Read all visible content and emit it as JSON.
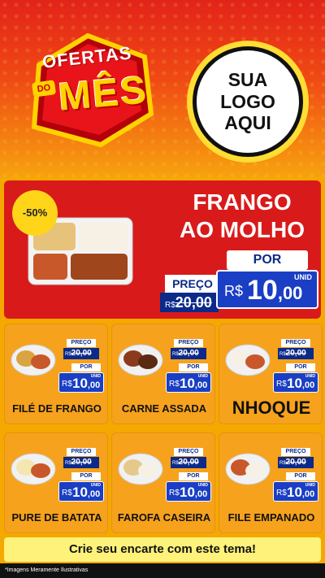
{
  "header": {
    "badge_top": "OFERTAS",
    "badge_do": "DO",
    "badge_main": "MÊS",
    "logo_lines": [
      "SUA",
      "LOGO",
      "AQUI"
    ]
  },
  "featured": {
    "discount": "-50%",
    "name_line1": "FRANGO",
    "name_line2": "AO MOLHO",
    "preco_label": "PREÇO",
    "old_currency": "R$",
    "old_price_int": "20",
    "old_price_dec": ",00",
    "por_label": "POR",
    "unid_label": "UNID",
    "new_currency": "R$",
    "new_price_int": "10",
    "new_price_dec": ",00"
  },
  "products": [
    {
      "name": "FILÉ DE FRANGO",
      "preco_label": "PREÇO",
      "old_currency": "R$",
      "old_price_int": "20",
      "old_price_dec": ",00",
      "por_label": "POR",
      "unid_label": "UNID",
      "new_currency": "R$",
      "new_price_int": "10",
      "new_price_dec": ",00"
    },
    {
      "name": "CARNE ASSADA",
      "preco_label": "PREÇO",
      "old_currency": "R$",
      "old_price_int": "20",
      "old_price_dec": ",00",
      "por_label": "POR",
      "unid_label": "UNID",
      "new_currency": "R$",
      "new_price_int": "10",
      "new_price_dec": ",00"
    },
    {
      "name": "NHOQUE",
      "preco_label": "PREÇO",
      "old_currency": "R$",
      "old_price_int": "20",
      "old_price_dec": ",00",
      "por_label": "POR",
      "unid_label": "UNID",
      "new_currency": "R$",
      "new_price_int": "10",
      "new_price_dec": ",00"
    },
    {
      "name": "PURE DE BATATA",
      "preco_label": "PREÇO",
      "old_currency": "R$",
      "old_price_int": "20",
      "old_price_dec": ",00",
      "por_label": "POR",
      "unid_label": "UNID",
      "new_currency": "R$",
      "new_price_int": "10",
      "new_price_dec": ",00"
    },
    {
      "name": "FAROFA CASEIRA",
      "preco_label": "PREÇO",
      "old_currency": "R$",
      "old_price_int": "20",
      "old_price_dec": ",00",
      "por_label": "POR",
      "unid_label": "UNID",
      "new_currency": "R$",
      "new_price_int": "10",
      "new_price_dec": ",00"
    },
    {
      "name": "FILE EMPANADO",
      "preco_label": "PREÇO",
      "old_currency": "R$",
      "old_price_int": "20",
      "old_price_dec": ",00",
      "por_label": "POR",
      "unid_label": "UNID",
      "new_currency": "R$",
      "new_price_int": "10",
      "new_price_dec": ",00"
    }
  ],
  "cta": "Crie seu encarte com este tema!",
  "footer": "*Imagens Meramente Ilustrativas",
  "colors": {
    "red": "#d91a1a",
    "orange": "#f6a21c",
    "blue": "#1a3ec4",
    "navy": "#0b2a8a",
    "yellow": "#ffd200"
  }
}
